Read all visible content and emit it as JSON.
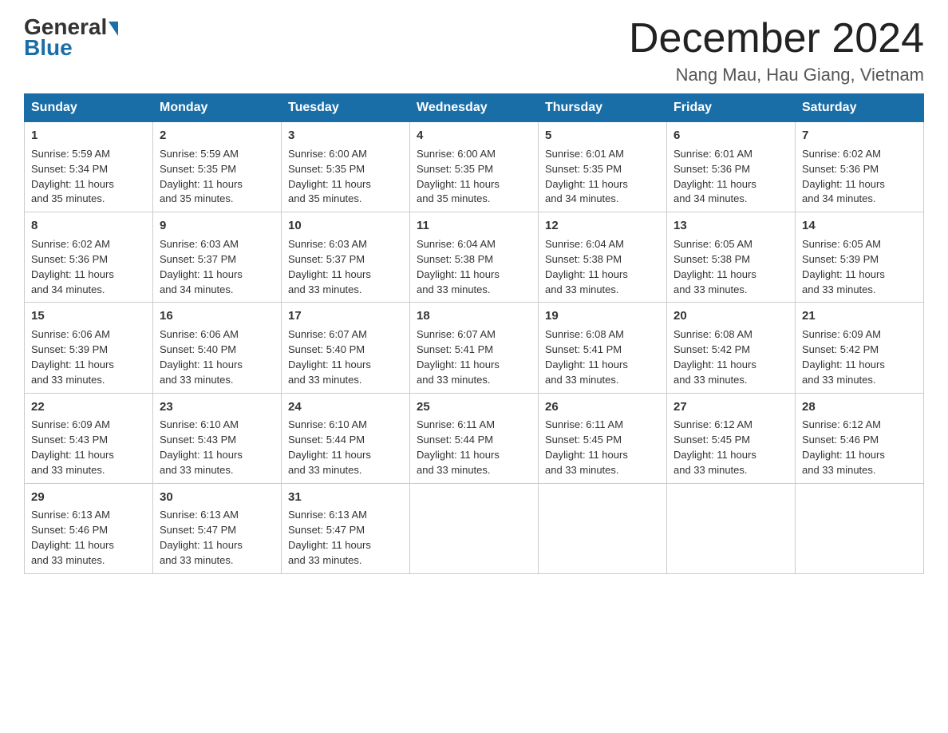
{
  "header": {
    "logo_general": "General",
    "logo_blue": "Blue",
    "month_year": "December 2024",
    "location": "Nang Mau, Hau Giang, Vietnam"
  },
  "days_of_week": [
    "Sunday",
    "Monday",
    "Tuesday",
    "Wednesday",
    "Thursday",
    "Friday",
    "Saturday"
  ],
  "weeks": [
    [
      {
        "day": "1",
        "sunrise": "5:59 AM",
        "sunset": "5:34 PM",
        "daylight": "11 hours and 35 minutes."
      },
      {
        "day": "2",
        "sunrise": "5:59 AM",
        "sunset": "5:35 PM",
        "daylight": "11 hours and 35 minutes."
      },
      {
        "day": "3",
        "sunrise": "6:00 AM",
        "sunset": "5:35 PM",
        "daylight": "11 hours and 35 minutes."
      },
      {
        "day": "4",
        "sunrise": "6:00 AM",
        "sunset": "5:35 PM",
        "daylight": "11 hours and 35 minutes."
      },
      {
        "day": "5",
        "sunrise": "6:01 AM",
        "sunset": "5:35 PM",
        "daylight": "11 hours and 34 minutes."
      },
      {
        "day": "6",
        "sunrise": "6:01 AM",
        "sunset": "5:36 PM",
        "daylight": "11 hours and 34 minutes."
      },
      {
        "day": "7",
        "sunrise": "6:02 AM",
        "sunset": "5:36 PM",
        "daylight": "11 hours and 34 minutes."
      }
    ],
    [
      {
        "day": "8",
        "sunrise": "6:02 AM",
        "sunset": "5:36 PM",
        "daylight": "11 hours and 34 minutes."
      },
      {
        "day": "9",
        "sunrise": "6:03 AM",
        "sunset": "5:37 PM",
        "daylight": "11 hours and 34 minutes."
      },
      {
        "day": "10",
        "sunrise": "6:03 AM",
        "sunset": "5:37 PM",
        "daylight": "11 hours and 33 minutes."
      },
      {
        "day": "11",
        "sunrise": "6:04 AM",
        "sunset": "5:38 PM",
        "daylight": "11 hours and 33 minutes."
      },
      {
        "day": "12",
        "sunrise": "6:04 AM",
        "sunset": "5:38 PM",
        "daylight": "11 hours and 33 minutes."
      },
      {
        "day": "13",
        "sunrise": "6:05 AM",
        "sunset": "5:38 PM",
        "daylight": "11 hours and 33 minutes."
      },
      {
        "day": "14",
        "sunrise": "6:05 AM",
        "sunset": "5:39 PM",
        "daylight": "11 hours and 33 minutes."
      }
    ],
    [
      {
        "day": "15",
        "sunrise": "6:06 AM",
        "sunset": "5:39 PM",
        "daylight": "11 hours and 33 minutes."
      },
      {
        "day": "16",
        "sunrise": "6:06 AM",
        "sunset": "5:40 PM",
        "daylight": "11 hours and 33 minutes."
      },
      {
        "day": "17",
        "sunrise": "6:07 AM",
        "sunset": "5:40 PM",
        "daylight": "11 hours and 33 minutes."
      },
      {
        "day": "18",
        "sunrise": "6:07 AM",
        "sunset": "5:41 PM",
        "daylight": "11 hours and 33 minutes."
      },
      {
        "day": "19",
        "sunrise": "6:08 AM",
        "sunset": "5:41 PM",
        "daylight": "11 hours and 33 minutes."
      },
      {
        "day": "20",
        "sunrise": "6:08 AM",
        "sunset": "5:42 PM",
        "daylight": "11 hours and 33 minutes."
      },
      {
        "day": "21",
        "sunrise": "6:09 AM",
        "sunset": "5:42 PM",
        "daylight": "11 hours and 33 minutes."
      }
    ],
    [
      {
        "day": "22",
        "sunrise": "6:09 AM",
        "sunset": "5:43 PM",
        "daylight": "11 hours and 33 minutes."
      },
      {
        "day": "23",
        "sunrise": "6:10 AM",
        "sunset": "5:43 PM",
        "daylight": "11 hours and 33 minutes."
      },
      {
        "day": "24",
        "sunrise": "6:10 AM",
        "sunset": "5:44 PM",
        "daylight": "11 hours and 33 minutes."
      },
      {
        "day": "25",
        "sunrise": "6:11 AM",
        "sunset": "5:44 PM",
        "daylight": "11 hours and 33 minutes."
      },
      {
        "day": "26",
        "sunrise": "6:11 AM",
        "sunset": "5:45 PM",
        "daylight": "11 hours and 33 minutes."
      },
      {
        "day": "27",
        "sunrise": "6:12 AM",
        "sunset": "5:45 PM",
        "daylight": "11 hours and 33 minutes."
      },
      {
        "day": "28",
        "sunrise": "6:12 AM",
        "sunset": "5:46 PM",
        "daylight": "11 hours and 33 minutes."
      }
    ],
    [
      {
        "day": "29",
        "sunrise": "6:13 AM",
        "sunset": "5:46 PM",
        "daylight": "11 hours and 33 minutes."
      },
      {
        "day": "30",
        "sunrise": "6:13 AM",
        "sunset": "5:47 PM",
        "daylight": "11 hours and 33 minutes."
      },
      {
        "day": "31",
        "sunrise": "6:13 AM",
        "sunset": "5:47 PM",
        "daylight": "11 hours and 33 minutes."
      },
      null,
      null,
      null,
      null
    ]
  ],
  "labels": {
    "sunrise": "Sunrise:",
    "sunset": "Sunset:",
    "daylight": "Daylight:"
  }
}
